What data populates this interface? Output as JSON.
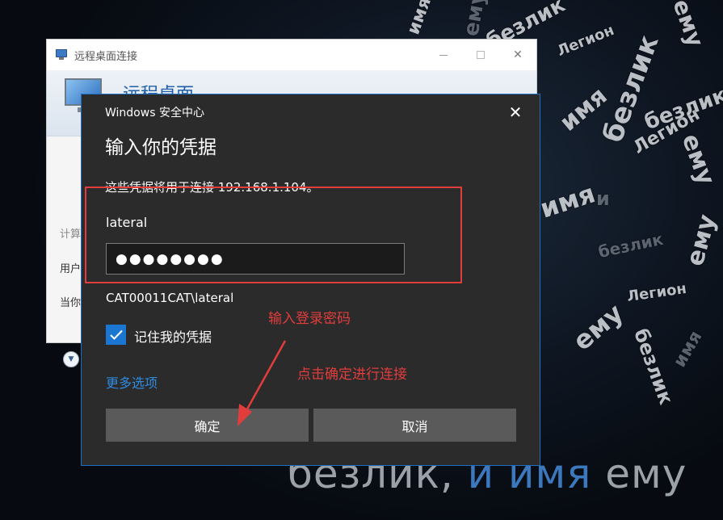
{
  "wallpaper": {
    "words": [
      "безлик",
      "и имя",
      "ему",
      "Легион",
      "безлик",
      "ему",
      "имя",
      "Легион",
      "безлик",
      "ему",
      "и",
      "имя",
      "безлик",
      "ему",
      "Легион",
      "безлик",
      "ему",
      "имя"
    ],
    "tagline_part1": "безлик, ",
    "tagline_part2": "и имя",
    "tagline_part3": " ему"
  },
  "rdc_window": {
    "title": "远程桌面连接",
    "heading": "远程桌面",
    "label_computer": "计算",
    "label_user": "用户",
    "label_current": "当你"
  },
  "security_dialog": {
    "caption": "Windows 安全中心",
    "title": "输入你的凭据",
    "description": "这些凭据将用于连接 192.168.1.104。",
    "username": "lateral",
    "password_mask": "●●●●●●●●",
    "domain_user": "CAT00011CAT\\lateral",
    "remember_label": "记住我的凭据",
    "remember_checked": true,
    "more_options": "更多选项",
    "ok_label": "确定",
    "cancel_label": "取消"
  },
  "annotations": {
    "enter_password": "输入登录密码",
    "click_ok": "点击确定进行连接",
    "color": "#e23d3d"
  },
  "colors": {
    "accent": "#1b76d2",
    "link": "#2f8be0",
    "dialog_bg": "#2b2b2b",
    "button_bg": "#5a5a5a"
  }
}
